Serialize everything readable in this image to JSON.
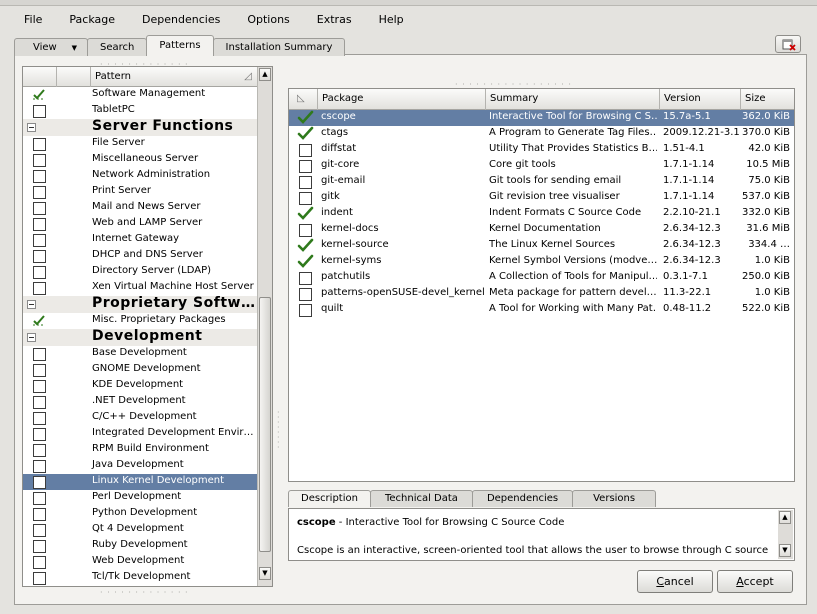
{
  "menubar": [
    "File",
    "Package",
    "Dependencies",
    "Options",
    "Extras",
    "Help"
  ],
  "tabs": {
    "view": "View",
    "search": "Search",
    "patterns": "Patterns",
    "summary": "Installation Summary"
  },
  "left": {
    "header": "Pattern",
    "rows": [
      {
        "kind": "item",
        "label": "Software Management",
        "state": "auto"
      },
      {
        "kind": "item",
        "label": "TabletPC",
        "state": "off"
      },
      {
        "kind": "cat",
        "label": "Server Functions"
      },
      {
        "kind": "item",
        "label": "File Server",
        "state": "off"
      },
      {
        "kind": "item",
        "label": "Miscellaneous Server",
        "state": "off"
      },
      {
        "kind": "item",
        "label": "Network Administration",
        "state": "off"
      },
      {
        "kind": "item",
        "label": "Print Server",
        "state": "off"
      },
      {
        "kind": "item",
        "label": "Mail and News Server",
        "state": "off"
      },
      {
        "kind": "item",
        "label": "Web and LAMP Server",
        "state": "off"
      },
      {
        "kind": "item",
        "label": "Internet Gateway",
        "state": "off"
      },
      {
        "kind": "item",
        "label": "DHCP and DNS Server",
        "state": "off"
      },
      {
        "kind": "item",
        "label": "Directory Server (LDAP)",
        "state": "off"
      },
      {
        "kind": "item",
        "label": "Xen Virtual Machine Host Server",
        "state": "off"
      },
      {
        "kind": "cat",
        "label": "Proprietary Softw…"
      },
      {
        "kind": "item",
        "label": "Misc. Proprietary Packages",
        "state": "auto"
      },
      {
        "kind": "cat",
        "label": "Development"
      },
      {
        "kind": "item",
        "label": "Base Development",
        "state": "off"
      },
      {
        "kind": "item",
        "label": "GNOME Development",
        "state": "off"
      },
      {
        "kind": "item",
        "label": "KDE Development",
        "state": "off"
      },
      {
        "kind": "item",
        "label": ".NET Development",
        "state": "off"
      },
      {
        "kind": "item",
        "label": "C/C++ Development",
        "state": "off"
      },
      {
        "kind": "item",
        "label": "Integrated Development Envir…",
        "state": "off"
      },
      {
        "kind": "item",
        "label": "RPM Build Environment",
        "state": "off"
      },
      {
        "kind": "item",
        "label": "Java Development",
        "state": "off"
      },
      {
        "kind": "item",
        "label": "Linux Kernel Development",
        "state": "off",
        "selected": true
      },
      {
        "kind": "item",
        "label": "Perl Development",
        "state": "off"
      },
      {
        "kind": "item",
        "label": "Python Development",
        "state": "off"
      },
      {
        "kind": "item",
        "label": "Qt 4 Development",
        "state": "off"
      },
      {
        "kind": "item",
        "label": "Ruby Development",
        "state": "off"
      },
      {
        "kind": "item",
        "label": "Web Development",
        "state": "off"
      },
      {
        "kind": "item",
        "label": "Tcl/Tk Development",
        "state": "off"
      }
    ]
  },
  "packages": {
    "headers": {
      "package": "Package",
      "summary": "Summary",
      "version": "Version",
      "size": "Size"
    },
    "rows": [
      {
        "name": "cscope",
        "summary": "Interactive Tool for Browsing C S…",
        "version": "15.7a-5.1",
        "size": "362.0 KiB",
        "installed": true,
        "selected": true
      },
      {
        "name": "ctags",
        "summary": "A Program to Generate Tag Files…",
        "version": "2009.12.21-3.1",
        "size": "370.0 KiB",
        "installed": true
      },
      {
        "name": "diffstat",
        "summary": "Utility That Provides Statistics B…",
        "version": "1.51-4.1",
        "size": "42.0 KiB",
        "installed": false
      },
      {
        "name": "git-core",
        "summary": "Core git tools",
        "version": "1.7.1-1.14",
        "size": "10.5 MiB",
        "installed": false
      },
      {
        "name": "git-email",
        "summary": "Git tools for sending email",
        "version": "1.7.1-1.14",
        "size": "75.0 KiB",
        "installed": false
      },
      {
        "name": "gitk",
        "summary": "Git revision tree visualiser",
        "version": "1.7.1-1.14",
        "size": "537.0 KiB",
        "installed": false
      },
      {
        "name": "indent",
        "summary": "Indent Formats C Source Code",
        "version": "2.2.10-21.1",
        "size": "332.0 KiB",
        "installed": true
      },
      {
        "name": "kernel-docs",
        "summary": "Kernel Documentation",
        "version": "2.6.34-12.3",
        "size": "31.6 MiB",
        "installed": false
      },
      {
        "name": "kernel-source",
        "summary": "The Linux Kernel Sources",
        "version": "2.6.34-12.3",
        "size": "334.4 …",
        "installed": true
      },
      {
        "name": "kernel-syms",
        "summary": "Kernel Symbol Versions (modve…",
        "version": "2.6.34-12.3",
        "size": "1.0 KiB",
        "installed": true
      },
      {
        "name": "patchutils",
        "summary": "A Collection of Tools for Manipul…",
        "version": "0.3.1-7.1",
        "size": "250.0 KiB",
        "installed": false
      },
      {
        "name": "patterns-openSUSE-devel_kernel",
        "summary": "Meta package for pattern devel…",
        "version": "11.3-22.1",
        "size": "1.0 KiB",
        "installed": false
      },
      {
        "name": "quilt",
        "summary": "A Tool for Working with Many Pat…",
        "version": "0.48-11.2",
        "size": "522.0 KiB",
        "installed": false
      }
    ]
  },
  "detail_tabs": {
    "description": "Description",
    "technical": "Technical Data",
    "dependencies": "Dependencies",
    "versions": "Versions"
  },
  "description": {
    "name": "cscope",
    "title_rest": " - Interactive Tool for Browsing C Source Code",
    "body": "Cscope is an interactive, screen-oriented tool that allows the user to browse through C source"
  },
  "buttons": {
    "cancel": "Cancel",
    "accept": "Accept"
  },
  "colors": {
    "selection": "#637ea4",
    "check": "#2f7a1c"
  }
}
